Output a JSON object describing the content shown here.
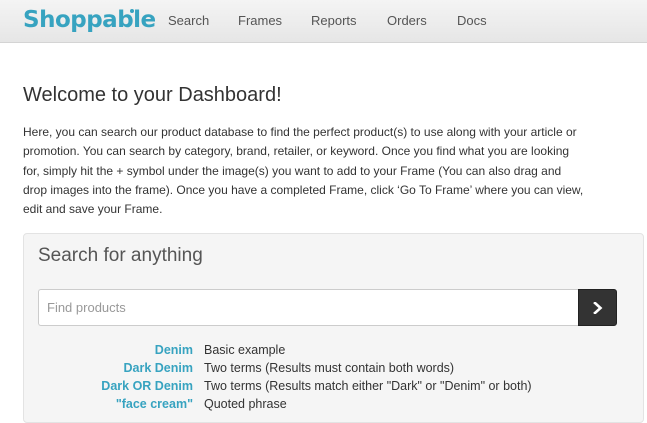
{
  "navbar": {
    "brand": "Shoppable",
    "links": [
      "Search",
      "Frames",
      "Reports",
      "Orders",
      "Docs"
    ]
  },
  "main": {
    "title": "Welcome to your Dashboard!",
    "intro_lines": [
      "Here, you can search our product database to find the perfect product(s) to use along with your article or",
      "promotion. You can search by category, brand, retailer, or keyword. Once you find what you are looking",
      "for, simply hit the + symbol under the image(s) you want to add to your Frame (You can also drag and",
      "drop images into the frame). Once you have a completed Frame, click ‘Go To Frame’ where you can view,",
      "edit and save your Frame."
    ]
  },
  "search": {
    "heading": "Search for anything",
    "placeholder": "Find products",
    "value": "",
    "button_icon": "chevron-right-icon",
    "examples": [
      {
        "term": "Denim",
        "desc": "Basic example"
      },
      {
        "term": "Dark Denim",
        "desc": "Two terms (Results must contain both words)"
      },
      {
        "term": "Dark OR Denim",
        "desc": "Two terms (Results match either \"Dark\" or \"Denim\" or both)"
      },
      {
        "term": "\"face cream\"",
        "desc": "Quoted phrase"
      }
    ]
  },
  "colors": {
    "brand": "#37a3c0",
    "navbar_bg": "#ececec",
    "button_bg": "#333333"
  }
}
